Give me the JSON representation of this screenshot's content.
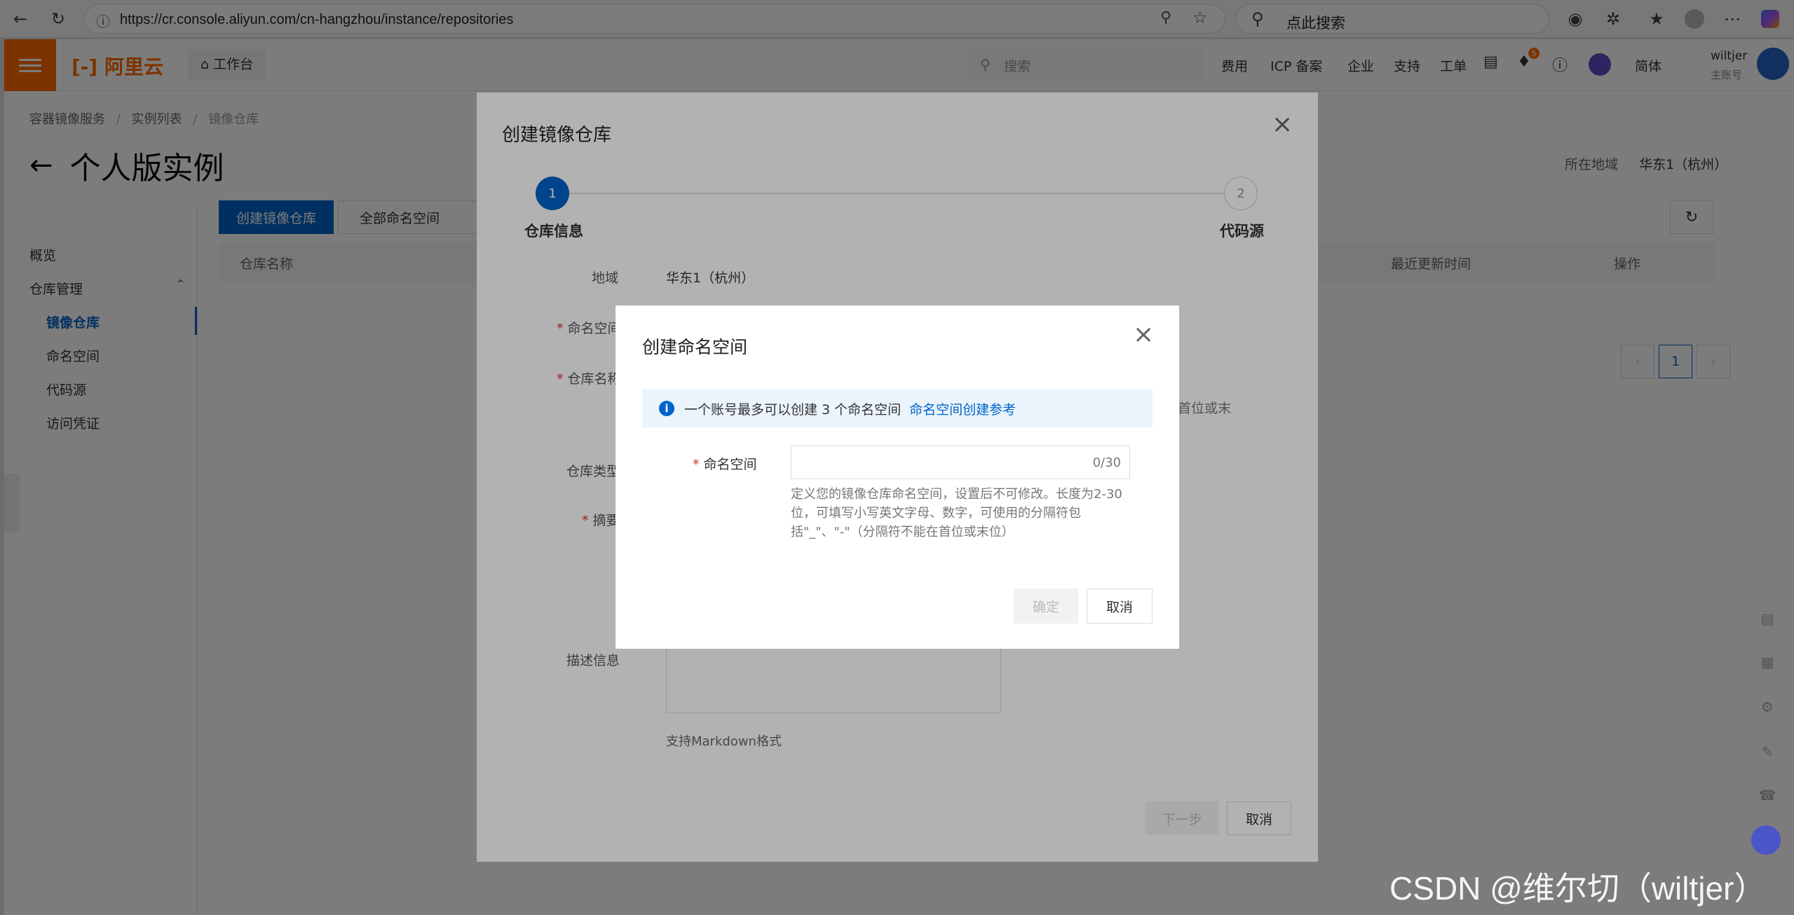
{
  "browser": {
    "url": "https://cr.console.aliyun.com/cn-hangzhou/instance/repositories",
    "search_placeholder": "点此搜索"
  },
  "console": {
    "logo": "阿里云",
    "workbench": "工作台",
    "search_placeholder": "搜索",
    "nav": [
      "费用",
      "ICP 备案",
      "企业",
      "支持",
      "工单"
    ],
    "language": "简体",
    "user": {
      "name": "wiltjer",
      "role": "主账号"
    },
    "notification_count": "5"
  },
  "breadcrumb": [
    "容器镜像服务",
    "实例列表",
    "镜像仓库"
  ],
  "page_title": "个人版实例",
  "region": {
    "label": "所在地域",
    "value": "华东1（杭州）"
  },
  "sidebar": {
    "overview": "概览",
    "repo_mgmt": "仓库管理",
    "items": [
      "镜像仓库",
      "命名空间",
      "代码源",
      "访问凭证"
    ]
  },
  "toolbar": {
    "create_repo": "创建镜像仓库",
    "ns_filter": "全部命名空间"
  },
  "table": {
    "headers": [
      "仓库名称",
      "最近更新时间",
      "操作"
    ]
  },
  "pager": {
    "current": "1"
  },
  "repo_dialog": {
    "title": "创建镜像仓库",
    "steps": [
      {
        "num": "1",
        "label": "仓库信息"
      },
      {
        "num": "2",
        "label": "代码源"
      }
    ],
    "fields": {
      "region_label": "地域",
      "region_value": "华东1（杭州）",
      "namespace_label": "命名空间",
      "repo_name_label": "仓库名称",
      "repo_type_label": "仓库类型",
      "summary_label": "摘要",
      "description_label": "描述信息",
      "repo_name_hint_tail": "首位或末",
      "markdown_hint": "支持Markdown格式"
    },
    "next": "下一步",
    "cancel": "取消"
  },
  "ns_dialog": {
    "title": "创建命名空间",
    "notice": "一个账号最多可以创建 3 个命名空间",
    "notice_link": "命名空间创建参考",
    "field_label": "命名空间",
    "input_value": "",
    "counter": "0/30",
    "help": "定义您的镜像仓库命名空间，设置后不可修改。长度为2-30位，可填写小写英文字母、数字，可使用的分隔符包括\"_\"、\"-\"（分隔符不能在首位或末位）",
    "confirm": "确定",
    "cancel": "取消"
  },
  "watermark": "CSDN @维尔切（wiltjer）"
}
